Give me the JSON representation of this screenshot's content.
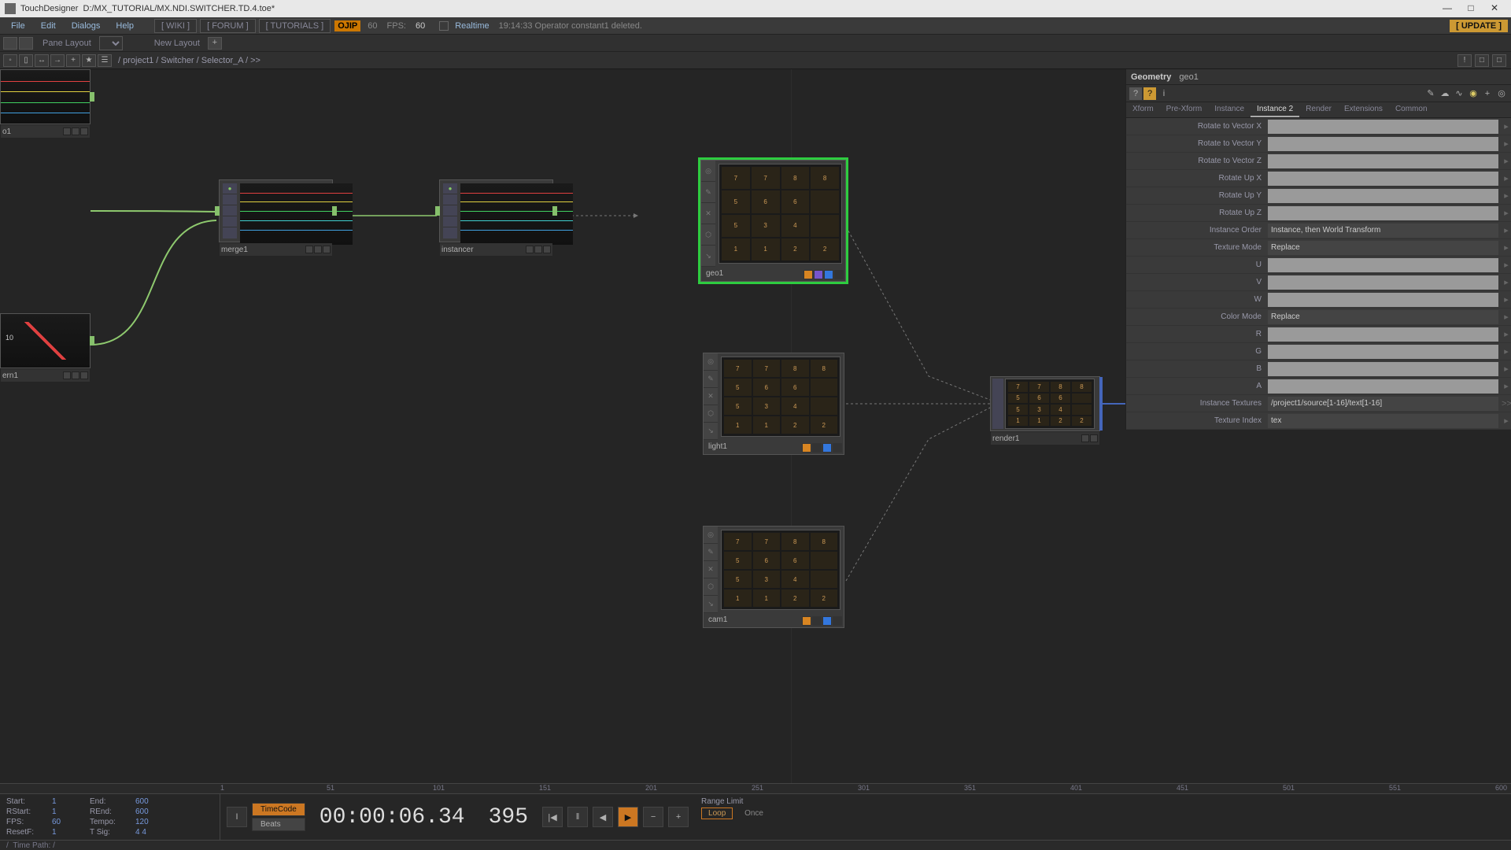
{
  "title": {
    "app": "TouchDesigner",
    "file": "D:/MX_TUTORIAL/MX.NDI.SWITCHER.TD.4.toe*"
  },
  "menu": {
    "items": [
      "File",
      "Edit",
      "Dialogs",
      "Help"
    ],
    "links": [
      "[ WIKI ]",
      "[ FORUM ]",
      "[ TUTORIALS ]"
    ],
    "ojip": "OJIP",
    "fps_num": "60",
    "fps_label": "FPS:",
    "fps_val": "60",
    "realtime": "Realtime",
    "status": "19:14:33 Operator constant1 deleted.",
    "update": "[ UPDATE ]"
  },
  "pane": {
    "layout_label": "Pane Layout",
    "new_layout": "New Layout"
  },
  "path": {
    "text": "/ project1 / Switcher / Selector_A / >>"
  },
  "nodes": {
    "o1": "o1",
    "ern1": "ern1",
    "merge1": "merge1",
    "instancer": "instancer",
    "geo1": "geo1",
    "light1": "light1",
    "cam1": "cam1",
    "render1": "render1"
  },
  "params": {
    "type": "Geometry",
    "name": "geo1",
    "tabs": [
      "Xform",
      "Pre-Xform",
      "Instance",
      "Instance 2",
      "Render",
      "Extensions",
      "Common"
    ],
    "active_tab": "Instance 2",
    "rows": [
      {
        "label": "Rotate to Vector X",
        "value": ""
      },
      {
        "label": "Rotate to Vector Y",
        "value": ""
      },
      {
        "label": "Rotate to Vector Z",
        "value": ""
      },
      {
        "label": "Rotate Up X",
        "value": ""
      },
      {
        "label": "Rotate Up Y",
        "value": ""
      },
      {
        "label": "Rotate Up Z",
        "value": ""
      },
      {
        "label": "Instance Order",
        "value": "Instance, then World Transform",
        "dark": true
      },
      {
        "label": "Texture Mode",
        "value": "Replace",
        "dark": true
      },
      {
        "label": "U",
        "value": ""
      },
      {
        "label": "V",
        "value": ""
      },
      {
        "label": "W",
        "value": ""
      },
      {
        "label": "Color Mode",
        "value": "Replace",
        "dark": true
      },
      {
        "label": "R",
        "value": ""
      },
      {
        "label": "G",
        "value": ""
      },
      {
        "label": "B",
        "value": ""
      },
      {
        "label": "A",
        "value": ""
      },
      {
        "label": "Instance Textures",
        "value": "/project1/source[1-16]/text[1-16]",
        "dark": true,
        "arrow": ">>"
      },
      {
        "label": "Texture Index",
        "value": "tex",
        "dark": true
      }
    ]
  },
  "timeline": {
    "ticks": [
      "1",
      "51",
      "101",
      "151",
      "201",
      "251",
      "301",
      "351",
      "401",
      "451",
      "501",
      "551",
      "600"
    ],
    "left": {
      "Start": "1",
      "End": "600",
      "RStart": "1",
      "REnd": "600",
      "FPS": "60",
      "Tempo": "120",
      "ResetF": "1",
      "TSig": "4   4"
    },
    "timecode_btn": "TimeCode",
    "beats_btn": "Beats",
    "time": "00:00:06.34",
    "frame": "395",
    "range_limit": "Range Limit",
    "loop": "Loop",
    "once": "Once",
    "timepath": "Time Path: /"
  },
  "grid_cells": [
    "7",
    "7",
    "8",
    "8",
    "5",
    "6",
    "6",
    "",
    "5",
    "3",
    "4",
    "",
    "1",
    "1",
    "2",
    "2"
  ]
}
